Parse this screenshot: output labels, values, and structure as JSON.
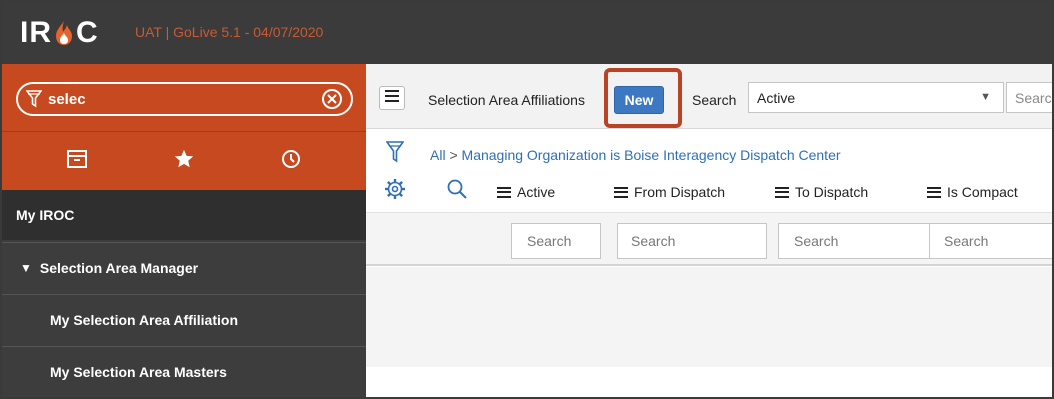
{
  "banner": {
    "logo_text": "IROC",
    "environment": "UAT | GoLive 5.1 - 04/07/2020"
  },
  "sidebar": {
    "filter_value": "selec",
    "icons": [
      "archive-icon",
      "star-icon",
      "clock-icon"
    ],
    "items": [
      {
        "label": "My IROC"
      },
      {
        "label": "Selection Area Manager"
      },
      {
        "label": "My Selection Area Affiliation"
      },
      {
        "label": "My Selection Area Masters"
      }
    ]
  },
  "toolbar": {
    "title": "Selection Area Affiliations",
    "new_label": "New",
    "search_label": "Search",
    "search_field_value": "Active",
    "search_box_placeholder": "Searc"
  },
  "filter": {
    "all_label": "All",
    "separator": ">",
    "condition": "Managing Organization is Boise Interagency Dispatch Center"
  },
  "columns": [
    "Active",
    "From Dispatch",
    "To Dispatch",
    "Is Compact"
  ],
  "column_search_placeholder": "Search",
  "colors": {
    "accent_orange": "#c7491f",
    "banner_dark": "#3b3b3b",
    "sidebar_dark": "#3d3d3d",
    "button_blue": "#3d79c2",
    "link_blue": "#2f6fb5",
    "highlight_outline": "#b94324"
  }
}
